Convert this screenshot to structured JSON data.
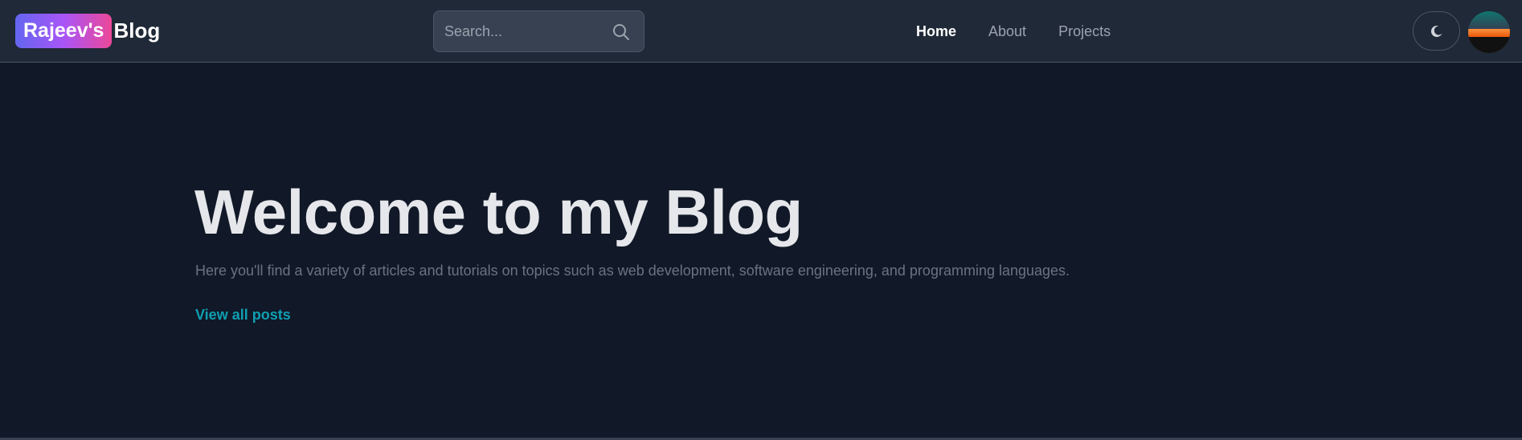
{
  "header": {
    "brand": {
      "badge": "Rajeev's",
      "text": "Blog"
    },
    "search": {
      "placeholder": "Search...",
      "icon": "search-icon"
    },
    "nav": [
      {
        "label": "Home",
        "active": true
      },
      {
        "label": "About",
        "active": false
      },
      {
        "label": "Projects",
        "active": false
      }
    ],
    "theme_toggle": {
      "icon": "moon-icon"
    },
    "avatar": {
      "icon": "avatar"
    }
  },
  "hero": {
    "title": "Welcome to my Blog",
    "description": "Here you'll find a variety of articles and tutorials on topics such as web development, software engineering, and programming languages.",
    "link": "View all posts"
  },
  "colors": {
    "background": "#111827",
    "navbar": "#1f2937",
    "accent_link": "#0e9fb2",
    "brand_gradient": [
      "#6366f1",
      "#a855f7",
      "#ec4899"
    ]
  }
}
